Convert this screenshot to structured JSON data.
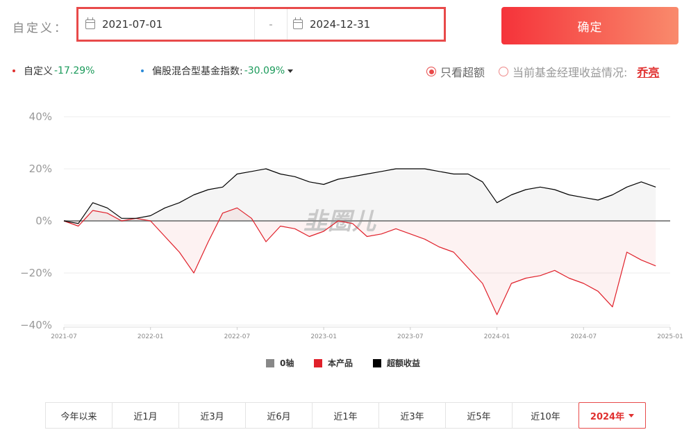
{
  "filter": {
    "label": "自定义：",
    "start_date": "2021-07-01",
    "separator": "-",
    "end_date": "2024-12-31",
    "confirm_label": "确定"
  },
  "summary": {
    "custom_label": "自定义",
    "custom_value": "-17.29%",
    "custom_color": "#e0302f",
    "index_label": "偏股混合型基金指数:",
    "index_value": "-30.09%",
    "index_color": "#2a8ad8",
    "option_excess": "只看超额",
    "option_manager": "当前基金经理收益情况:",
    "manager_name": "乔亮"
  },
  "watermark": "韭圈儿",
  "chart_data": {
    "type": "line",
    "x_ticks": [
      "2021-07",
      "2022-01",
      "2022-07",
      "2023-01",
      "2023-07",
      "2024-01",
      "2024-07",
      "2025-01"
    ],
    "y_ticks": [
      "40%",
      "20%",
      "0%",
      "−20%",
      "−40%"
    ],
    "ylim": [
      -40,
      40
    ],
    "series": [
      {
        "name": "0轴",
        "color": "#888888",
        "x": [
          "2021-07",
          "2025-01"
        ],
        "y": [
          0,
          0
        ]
      },
      {
        "name": "本产品",
        "color": "#e0202a",
        "x": [
          "2021-07",
          "2021-08",
          "2021-09",
          "2021-10",
          "2021-11",
          "2021-12",
          "2022-01",
          "2022-02",
          "2022-03",
          "2022-04",
          "2022-05",
          "2022-06",
          "2022-07",
          "2022-08",
          "2022-09",
          "2022-10",
          "2022-11",
          "2022-12",
          "2023-01",
          "2023-02",
          "2023-03",
          "2023-04",
          "2023-05",
          "2023-06",
          "2023-07",
          "2023-08",
          "2023-09",
          "2023-10",
          "2023-11",
          "2023-12",
          "2024-01",
          "2024-02",
          "2024-03",
          "2024-04",
          "2024-05",
          "2024-06",
          "2024-07",
          "2024-08",
          "2024-09",
          "2024-10",
          "2024-11",
          "2024-12"
        ],
        "y": [
          0,
          -2,
          4,
          3,
          0,
          1,
          0,
          -6,
          -12,
          -20,
          -8,
          3,
          5,
          1,
          -8,
          -2,
          -3,
          -6,
          -4,
          0,
          -1,
          -6,
          -5,
          -3,
          -5,
          -7,
          -10,
          -12,
          -18,
          -24,
          -36,
          -24,
          -22,
          -21,
          -19,
          -22,
          -24,
          -27,
          -33,
          -12,
          -15,
          -17.29
        ]
      },
      {
        "name": "超额收益",
        "color": "#000000",
        "x": [
          "2021-07",
          "2021-08",
          "2021-09",
          "2021-10",
          "2021-11",
          "2021-12",
          "2022-01",
          "2022-02",
          "2022-03",
          "2022-04",
          "2022-05",
          "2022-06",
          "2022-07",
          "2022-08",
          "2022-09",
          "2022-10",
          "2022-11",
          "2022-12",
          "2023-01",
          "2023-02",
          "2023-03",
          "2023-04",
          "2023-05",
          "2023-06",
          "2023-07",
          "2023-08",
          "2023-09",
          "2023-10",
          "2023-11",
          "2023-12",
          "2024-01",
          "2024-02",
          "2024-03",
          "2024-04",
          "2024-05",
          "2024-06",
          "2024-07",
          "2024-08",
          "2024-09",
          "2024-10",
          "2024-11",
          "2024-12"
        ],
        "y": [
          0,
          -1,
          7,
          5,
          1,
          1,
          2,
          5,
          7,
          10,
          12,
          13,
          18,
          19,
          20,
          18,
          17,
          15,
          14,
          16,
          17,
          18,
          19,
          20,
          20,
          20,
          19,
          18,
          18,
          15,
          7,
          10,
          12,
          13,
          12,
          10,
          9,
          8,
          10,
          13,
          15,
          13
        ]
      }
    ]
  },
  "legend": [
    {
      "label": "0轴",
      "color": "#888888"
    },
    {
      "label": "本产品",
      "color": "#e0202a"
    },
    {
      "label": "超额收益",
      "color": "#000000"
    }
  ],
  "tabs": [
    "今年以来",
    "近1月",
    "近3月",
    "近6月",
    "近1年",
    "近3年",
    "近5年",
    "近10年",
    "2024年"
  ]
}
